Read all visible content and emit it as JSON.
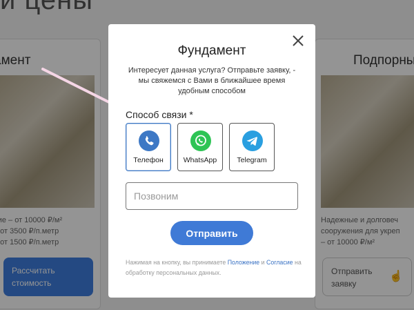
{
  "background": {
    "heading": "и цены",
    "left_card": {
      "title": "амент",
      "text_lines": [
        "чие – от 10000 ₽/м²",
        "– от 3500 ₽/п.метр",
        "– от 1500 ₽/п.метр"
      ],
      "button_label_1": "Рассчитать",
      "button_label_2": "стоимость"
    },
    "right_card": {
      "title": "Подпорны",
      "text_lines": [
        "Надежные и долговеч",
        "сооружения для укреп",
        "– от 10000 ₽/м²"
      ],
      "button_label_1": "Отправить",
      "button_label_2": "заявку"
    }
  },
  "modal": {
    "title": "Фундамент",
    "description": "Интересует данная услуга? Отправьте заявку, - мы свяжемся с Вами в ближайшее время удобным способом",
    "contact_label": "Способ связи *",
    "methods": [
      {
        "label": "Телефон",
        "icon": "phone-icon",
        "color": "#3d78c5",
        "selected": true
      },
      {
        "label": "WhatsApp",
        "icon": "whatsapp-icon",
        "color": "#2ec455",
        "selected": false
      },
      {
        "label": "Telegram",
        "icon": "telegram-icon",
        "color": "#2a9fe0",
        "selected": false
      }
    ],
    "input_placeholder": "Позвоним",
    "submit_label": "Отправить",
    "consent_prefix": "Нажимая на кнопку, вы принимаете ",
    "consent_link1": "Положение",
    "consent_mid": " и ",
    "consent_link2": "Согласие",
    "consent_suffix": " на обработку персональных данных."
  },
  "colors": {
    "accent": "#3f7ad6",
    "overlay": "rgba(0,0,0,0.42)",
    "arrow": "#f5d6e6"
  }
}
